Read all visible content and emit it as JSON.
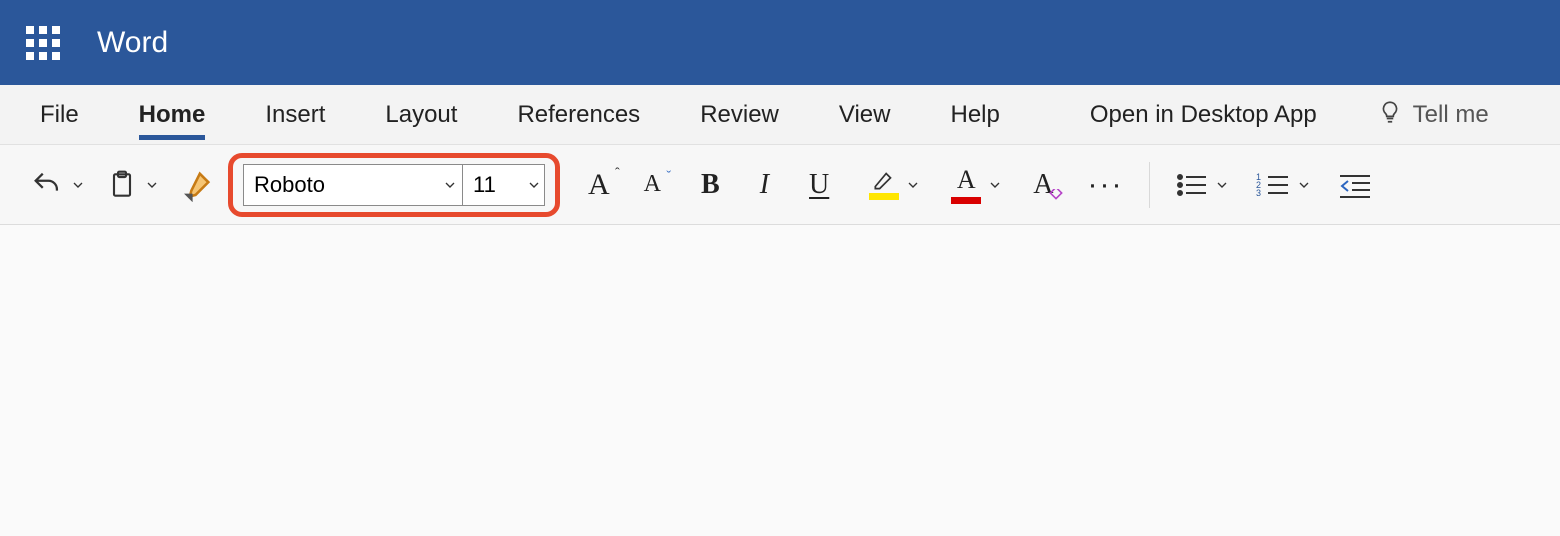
{
  "header": {
    "app_title": "Word"
  },
  "tabs": {
    "items": [
      "File",
      "Home",
      "Insert",
      "Layout",
      "References",
      "Review",
      "View",
      "Help"
    ],
    "active_index": 1,
    "open_desktop": "Open in Desktop App",
    "tell_me": "Tell me"
  },
  "ribbon": {
    "font_name": "Roboto",
    "font_size": "11",
    "highlight_color": "#ffe600",
    "font_color": "#d90000",
    "more": "···"
  }
}
